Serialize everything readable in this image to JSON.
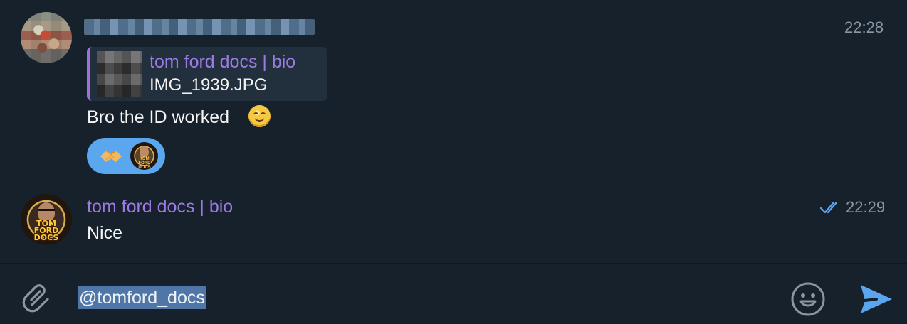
{
  "messages": [
    {
      "sender_name": "",
      "time": "22:28",
      "reply": {
        "sender": "tom ford docs | bio",
        "file_name": "IMG_1939.JPG"
      },
      "text": "Bro the ID worked",
      "emoji": "smiling-face",
      "reactions": [
        {
          "emoji": "handshake"
        }
      ]
    },
    {
      "sender_name": "tom ford docs | bio",
      "avatar_text": "TOM FORD DOCS",
      "time": "22:29",
      "text": "Nice",
      "status": "read"
    }
  ],
  "composer": {
    "value": "@tomford_docs"
  },
  "icons": {
    "attach": "paperclip-icon",
    "emoji": "emoji-icon",
    "send": "send-icon"
  },
  "colors": {
    "background": "#17212b",
    "accent": "#5ba4ef",
    "name": "#9b7be3",
    "secondary_text": "#8a96a3",
    "selection": "#4f76a6"
  }
}
